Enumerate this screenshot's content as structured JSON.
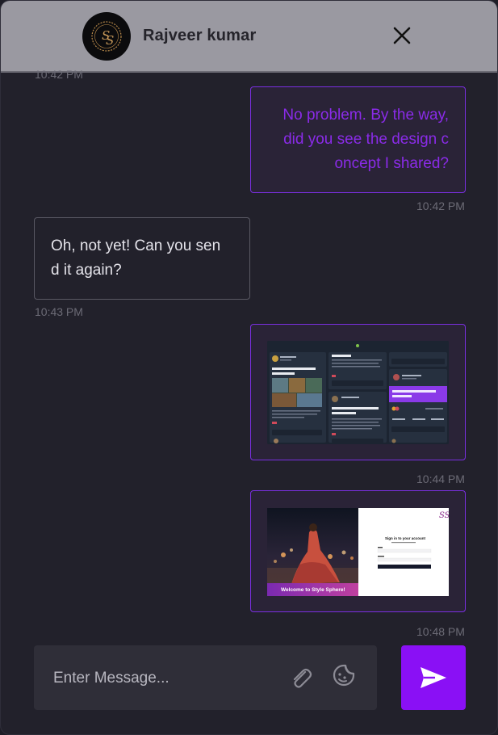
{
  "header": {
    "contact_name": "Rajveer kumar",
    "avatar_monogram": "SS",
    "close_icon": "close-icon"
  },
  "messages": [
    {
      "direction": "in",
      "type": "text",
      "text": "",
      "time": "10:42 PM"
    },
    {
      "direction": "out",
      "type": "text",
      "lines": [
        "No problem. By the way,",
        "did you see the design c",
        "oncept I shared?"
      ],
      "time": "10:42 PM"
    },
    {
      "direction": "in",
      "type": "text",
      "lines": [
        "Oh, not yet! Can you sen",
        "d it again?"
      ],
      "time": "10:43 PM"
    },
    {
      "direction": "out",
      "type": "image",
      "image_text": {
        "col1_title": "Web Design templates Selection",
        "col2_heading": "Selection",
        "col2_title": "Web Design templates Selection",
        "col3_title": "Web Design templates Selection"
      },
      "time": "10:44 PM"
    },
    {
      "direction": "out",
      "type": "image",
      "image_text": {
        "banner": "Welcome to Style Sphere!",
        "form_title": "Sign in to your account",
        "logo": "SS"
      },
      "time": "10:48 PM"
    }
  ],
  "composer": {
    "placeholder": "Enter Message...",
    "attach_icon": "paperclip-icon",
    "emoji_icon": "sticker-emoji-icon",
    "send_icon": "send-icon"
  },
  "colors": {
    "background": "#22212b",
    "header": "#9a99a1",
    "accent": "#8a10f5",
    "outgoing_text": "#8a2be8",
    "outgoing_border": "#7a2fe0",
    "timestamp": "#6c6b76"
  }
}
